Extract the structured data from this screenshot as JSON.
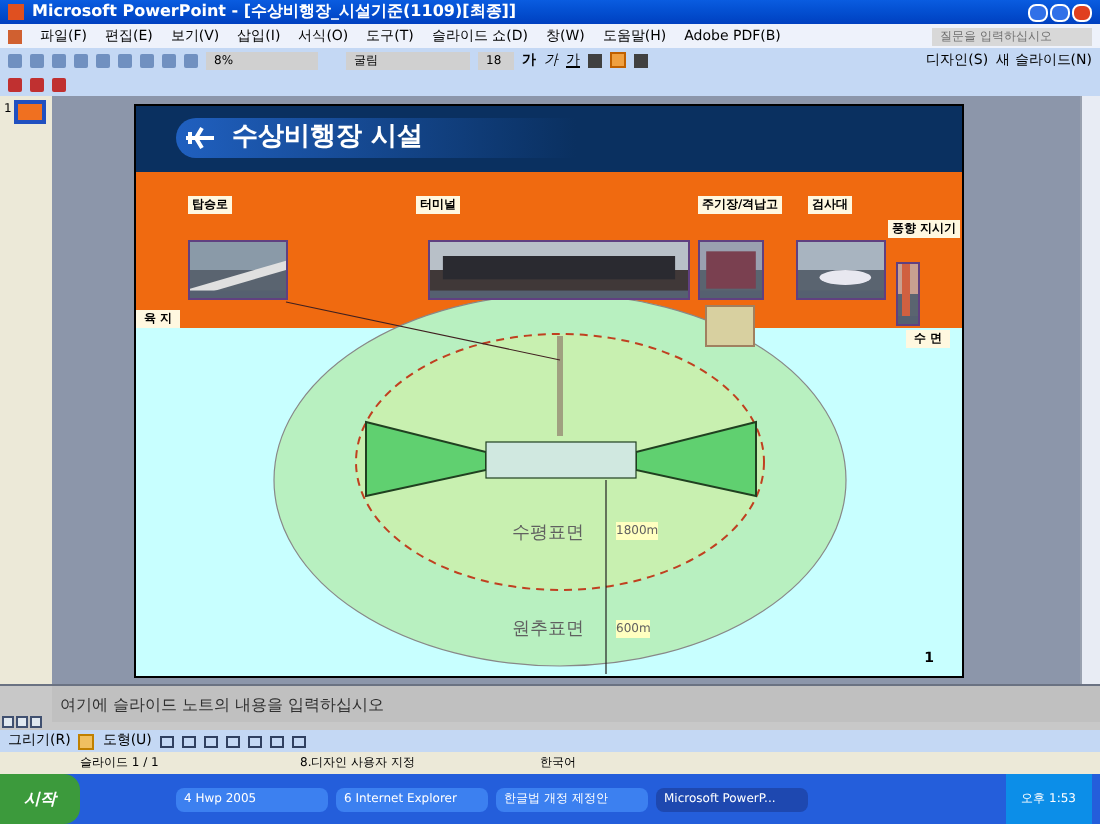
{
  "window": {
    "title": "Microsoft PowerPoint - [수상비행장_시설기준(1109)[최종]]"
  },
  "menu": [
    "파일(F)",
    "편집(E)",
    "보기(V)",
    "삽입(I)",
    "서식(O)",
    "도구(T)",
    "슬라이드 쇼(D)",
    "창(W)",
    "도움말(H)",
    "Adobe PDF(B)"
  ],
  "help_box": {
    "placeholder": "질문을 입력하십시오"
  },
  "toolbar": {
    "zoom": "8%",
    "font": "굴림",
    "size": "18",
    "bold_label": "가",
    "italic_label": "가",
    "underline_label": "가",
    "center_selected": true,
    "design": "디자인(S)",
    "new_slide": "새 슬라이드(N)"
  },
  "thumbnails": [
    {
      "number": "1",
      "selected": true
    }
  ],
  "slide": {
    "title": "수상비행장 시설",
    "photo_labels": [
      {
        "label": "탑승로"
      },
      {
        "label": "터미널"
      },
      {
        "label": "주기장/격납고"
      },
      {
        "label": "검사대"
      },
      {
        "label": "풍향 지시기"
      }
    ],
    "land_label": "육 지",
    "water_label": "수 면",
    "diagram_labels": [
      "수평표면",
      "1800m",
      "원추표면",
      "600m"
    ],
    "page_number": "1"
  },
  "notes": {
    "placeholder": "여기에 슬라이드 노트의 내용을 입력하십시오"
  },
  "draw_toolbar": {
    "draw": "그리기(R)",
    "shapes": "도형(U)"
  },
  "status_bar": [
    "슬라이드 1 / 1",
    "8.디자인 사용자 지정",
    "한국어"
  ],
  "taskbar": {
    "start": "시작",
    "tasks": [
      {
        "label": "4 Hwp 2005",
        "selected": false
      },
      {
        "label": "6 Internet Explorer",
        "selected": false
      },
      {
        "label": "한글법 개정 제정안",
        "selected": false
      },
      {
        "label": "Microsoft PowerP...",
        "selected": true
      }
    ],
    "clock": "오후 1:53"
  }
}
